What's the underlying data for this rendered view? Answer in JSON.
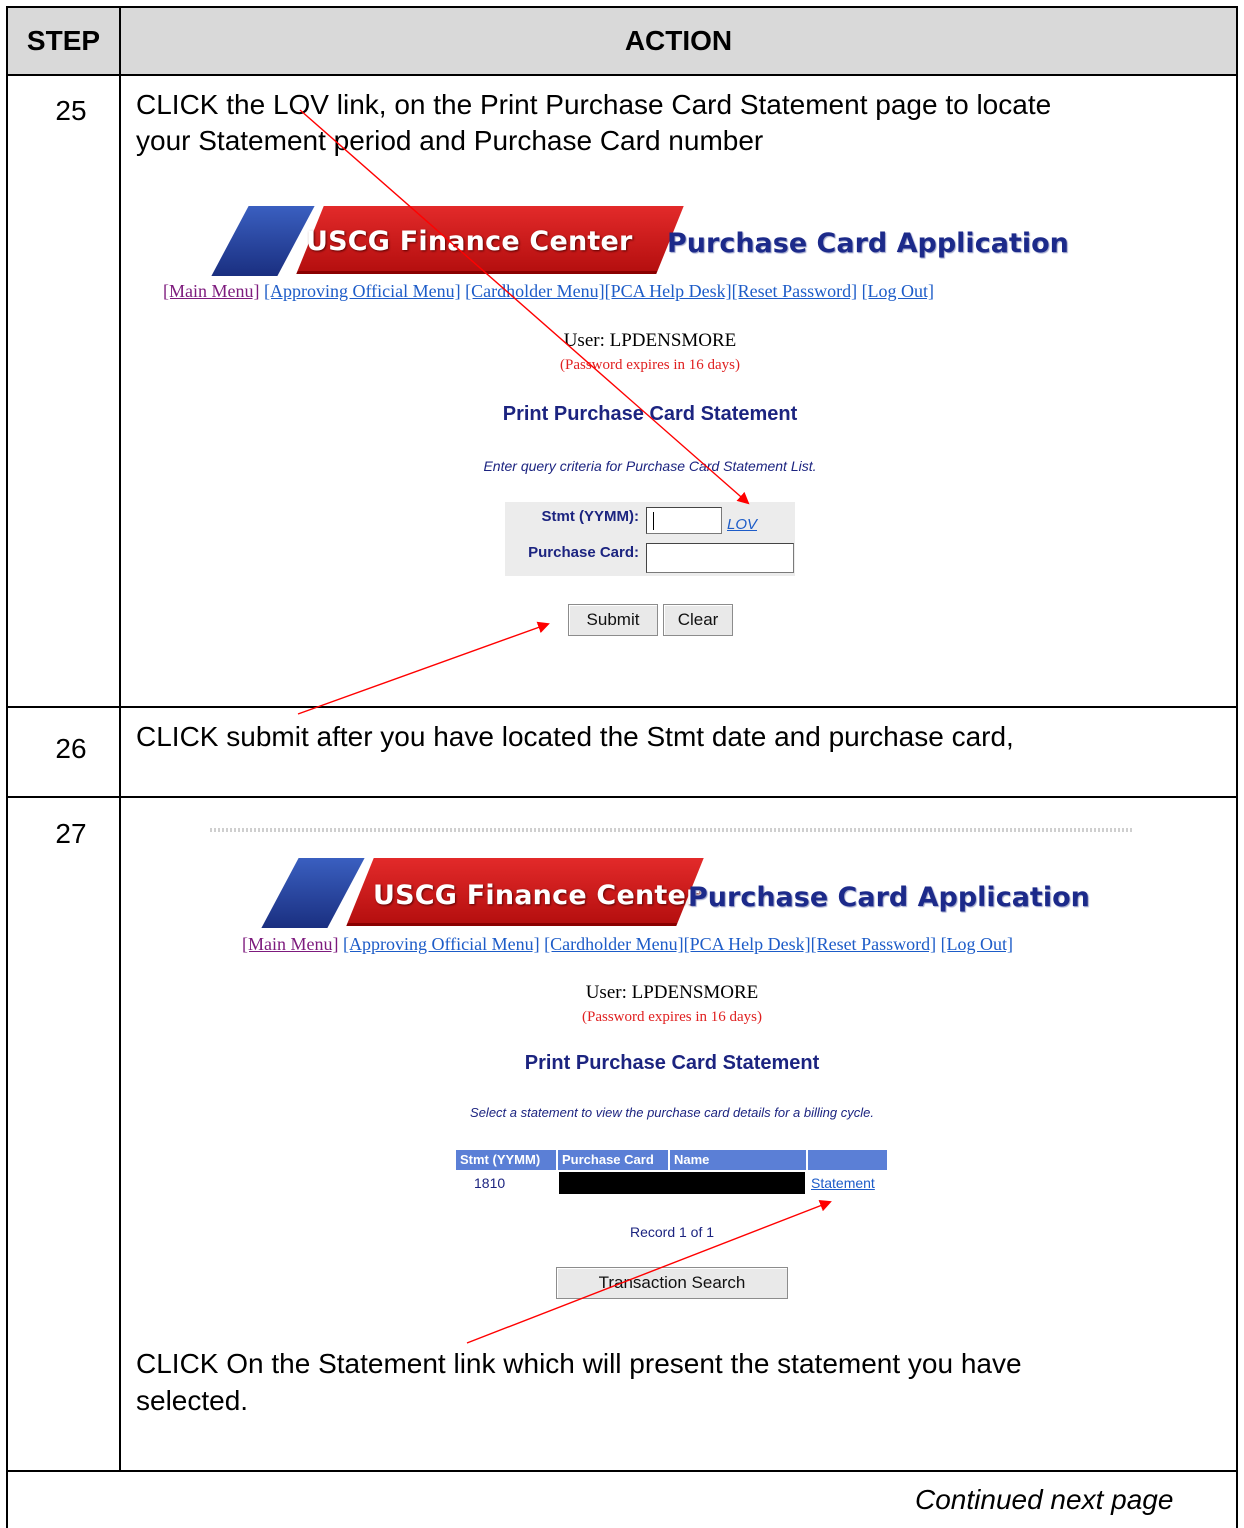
{
  "table": {
    "header_step": "STEP",
    "header_action": "ACTION",
    "continued": "Continued next page"
  },
  "steps": [
    {
      "number": "25",
      "text_line1": "CLICK the LOV link, on the Print Purchase Card Statement page to locate",
      "text_line2": "your Statement period and Purchase Card number"
    },
    {
      "number": "26",
      "text_line1": "CLICK submit after you have located the Stmt date and purchase card,"
    },
    {
      "number": "27",
      "text_line1": "CLICK On the Statement link which will present the statement you have",
      "text_line2": "selected."
    }
  ],
  "app": {
    "banner_red": "USCG Finance Center",
    "banner_blue": "Purchase Card Application",
    "menu": {
      "main": "[Main Menu]",
      "approving": "[Approving Official Menu]",
      "cardholder": "[Cardholder Menu]",
      "helpdesk": "[PCA Help Desk]",
      "reset": "[Reset Password]",
      "logout": "[Log Out]"
    },
    "user": "User: LPDENSMORE",
    "password_notice": "(Password expires in 16 days)",
    "page_title": "Print Purchase Card Statement"
  },
  "screen1": {
    "hint": "Enter query criteria for Purchase Card Statement List.",
    "stmt_label": "Stmt (YYMM):",
    "stmt_value": "",
    "lov": "LOV",
    "card_label": "Purchase Card:",
    "card_value": "",
    "submit": "Submit",
    "clear": "Clear"
  },
  "screen2": {
    "hint": "Select a statement to view the purchase card details for a billing cycle.",
    "columns": [
      "Stmt (YYMM)",
      "Purchase Card",
      "Name",
      ""
    ],
    "row": {
      "stmt": "1810",
      "link": "Statement"
    },
    "record": "Record 1 of 1",
    "search_button": "Transaction Search"
  },
  "colors": {
    "header_bg": "#d9d9d9",
    "arrow": "#ff0000",
    "title_navy": "#1c2480",
    "link_blue": "#1d5cc8",
    "table_head": "#5b7fd6"
  }
}
